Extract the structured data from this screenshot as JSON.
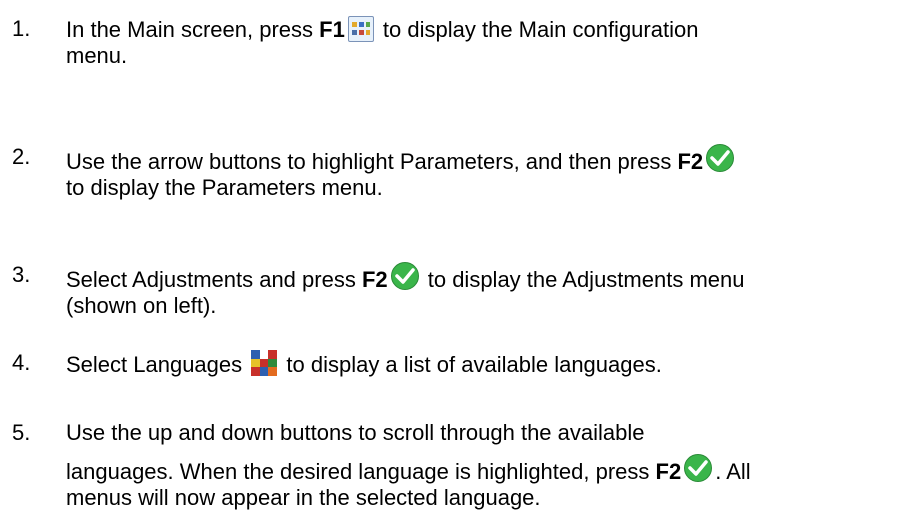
{
  "steps": [
    {
      "number": "1.",
      "line1_a": "In the Main screen, press ",
      "key1": "F1",
      "line1_b": " to display the Main configuration",
      "line2": "menu.",
      "icon": "main-config-icon"
    },
    {
      "number": "2.",
      "line1_a": "Use the arrow buttons to highlight Parameters, and then press ",
      "key1": "F2",
      "line2": "to display the Parameters menu.",
      "icon": "green-check-icon"
    },
    {
      "number": "3.",
      "line1_a": "Select Adjustments and press ",
      "key1": "F2",
      "line1_b": " to display the Adjustments menu",
      "line2": "(shown on left).",
      "icon": "green-check-icon"
    },
    {
      "number": "4.",
      "line1_a": "Select Languages ",
      "line1_b": " to display a list of available languages.",
      "icon": "languages-icon"
    },
    {
      "number": "5.",
      "line1": "Use the up and down buttons to scroll through the available",
      "line2_a": "languages. When the desired language is highlighted, press ",
      "key1": "F2",
      "line2_b": ". All",
      "line3": "menus will now appear in the selected language.",
      "icon": "green-check-icon"
    }
  ],
  "colors": {
    "check": "#3ab54a",
    "text": "#000000"
  }
}
